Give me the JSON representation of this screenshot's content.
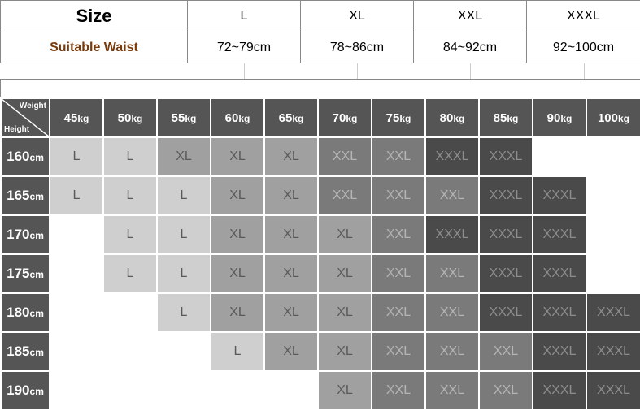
{
  "chart_data": {
    "type": "table",
    "title": "Size chart by height and weight",
    "size_waist": {
      "header": "Size",
      "waist_label": "Suitable Waist",
      "sizes": [
        "L",
        "XL",
        "XXL",
        "XXXL"
      ],
      "waist": [
        "72~79cm",
        "78~86cm",
        "84~92cm",
        "92~100cm"
      ]
    },
    "grid": {
      "corner": {
        "weight": "Weight",
        "height": "Height"
      },
      "weights": [
        "45kg",
        "50kg",
        "55kg",
        "60kg",
        "65kg",
        "70kg",
        "75kg",
        "80kg",
        "85kg",
        "90kg",
        "100kg"
      ],
      "heights": [
        "160cm",
        "165cm",
        "170cm",
        "175cm",
        "180cm",
        "185cm",
        "190cm"
      ],
      "cells": [
        [
          "L",
          "L",
          "XL",
          "XL",
          "XL",
          "XXL",
          "XXL",
          "XXXL",
          "XXXL",
          "",
          ""
        ],
        [
          "L",
          "L",
          "L",
          "XL",
          "XL",
          "XXL",
          "XXL",
          "XXL",
          "XXXL",
          "XXXL",
          ""
        ],
        [
          "",
          "L",
          "L",
          "XL",
          "XL",
          "XL",
          "XXL",
          "XXXL",
          "XXXL",
          "XXXL",
          ""
        ],
        [
          "",
          "L",
          "L",
          "XL",
          "XL",
          "XL",
          "XXL",
          "XXL",
          "XXXL",
          "XXXL",
          ""
        ],
        [
          "",
          "",
          "L",
          "XL",
          "XL",
          "XL",
          "XXL",
          "XXL",
          "XXXL",
          "XXXL",
          "XXXL"
        ],
        [
          "",
          "",
          "",
          "L",
          "XL",
          "XL",
          "XXL",
          "XXL",
          "XXL",
          "XXXL",
          "XXXL"
        ],
        [
          "",
          "",
          "",
          "",
          "",
          "XL",
          "XXL",
          "XXL",
          "XXL",
          "XXXL",
          "XXXL"
        ]
      ]
    }
  }
}
